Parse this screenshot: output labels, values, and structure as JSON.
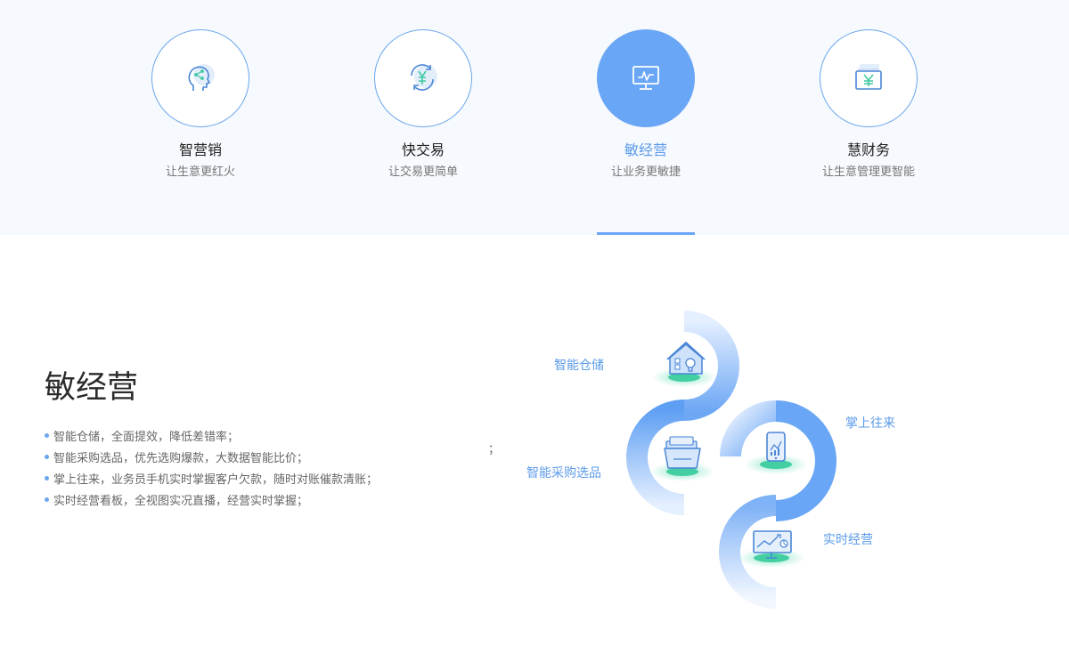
{
  "tabs": [
    {
      "title": "智营销",
      "subtitle": "让生意更红火",
      "icon": "brain-icon"
    },
    {
      "title": "快交易",
      "subtitle": "让交易更简单",
      "icon": "yuan-exchange-icon"
    },
    {
      "title": "敏经营",
      "subtitle": "让业务更敏捷",
      "icon": "monitor-chart-icon"
    },
    {
      "title": "慧财务",
      "subtitle": "让生意管理更智能",
      "icon": "yuan-ticket-icon"
    }
  ],
  "active_tab": 2,
  "section": {
    "title": "敏经营",
    "bullets": [
      "智能仓储，全面提效，降低差错率；",
      "智能采购选品，优先选购爆款，大数据智能比价；",
      "掌上往来，业务员手机实时掌握客户欠款，随时对账催款清账；",
      "实时经营看板，全视图实况直播，经营实时掌握；"
    ],
    "stray_mark": "；"
  },
  "diagram": {
    "labels": {
      "storage": "智能仓储",
      "palm": "掌上往来",
      "purchase": "智能采购选品",
      "realtime": "实时经营"
    },
    "icons": [
      "warehouse-icon",
      "folder-icon",
      "phone-chart-icon",
      "dashboard-icon"
    ]
  },
  "colors": {
    "accent": "#6aa6f6",
    "accent_text": "#5b9bea",
    "icon_green": "#3fcaa0",
    "top_bg": "#f6f9fd"
  }
}
